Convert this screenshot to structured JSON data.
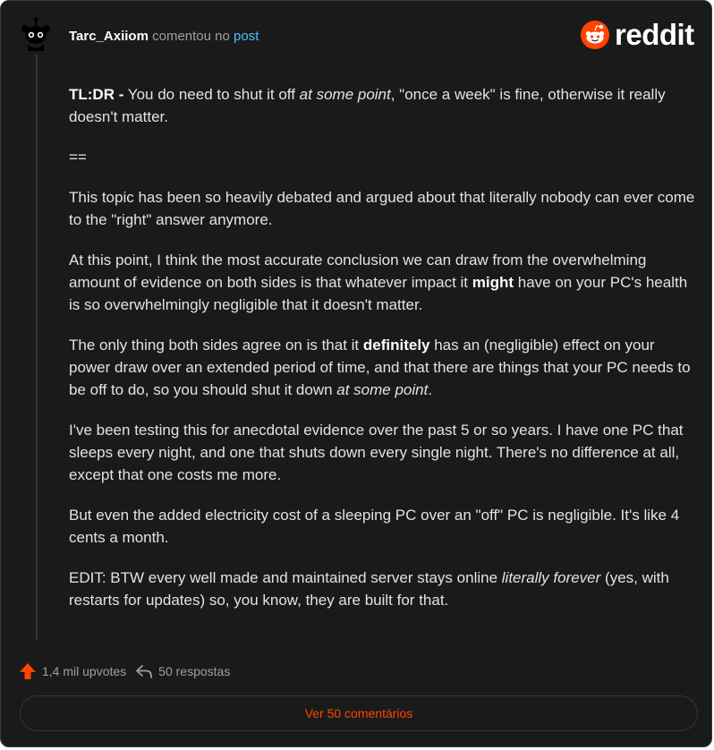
{
  "header": {
    "username": "Tarc_Axiiom",
    "action": "comentou no",
    "post_link": "post"
  },
  "brand": {
    "name": "reddit",
    "color": "#ff4500"
  },
  "comment": {
    "p1": {
      "bold": "TL:DR -",
      "text_a": " You do need to shut it off ",
      "italic": "at some point",
      "text_b": ", \"once a week\" is fine, otherwise it really doesn't matter."
    },
    "p2": "==",
    "p3": "This topic has been so heavily debated and argued about that literally nobody can ever come to the \"right\" answer anymore.",
    "p4": {
      "text_a": "At this point, I think the most accurate conclusion we can draw from the overwhelming amount of evidence on both sides is that whatever impact it ",
      "bold": "might",
      "text_b": " have on your PC's health is so overwhelmingly negligible that it doesn't matter."
    },
    "p5": {
      "text_a": "The only thing both sides agree on is that it ",
      "bold": "definitely",
      "text_b": " has an (negligible) effect on your power draw over an extended period of time, and that there are things that your PC needs to be off to do, so you should shut it down ",
      "italic": "at some point",
      "text_c": "."
    },
    "p6": "I've been testing this for anecdotal evidence over the past 5 or so years. I have one PC that sleeps every night, and one that shuts down every single night. There's no difference at all, except that one costs me more.",
    "p7": "But even the added electricity cost of a sleeping PC over an \"off\" PC is negligible. It's like 4 cents a month.",
    "p8": {
      "text_a": "EDIT: BTW every well made and maintained server stays online ",
      "italic": "literally forever",
      "text_b": " (yes, with restarts for updates) so, you know, they are built for that."
    }
  },
  "footer": {
    "upvotes": "1,4 mil upvotes",
    "replies": "50 respostas",
    "upvote_icon": "upvote-arrow-icon",
    "reply_icon": "reply-arrow-icon",
    "upvote_color": "#ff4500"
  },
  "view_button": {
    "label": "Ver 50 comentários"
  }
}
